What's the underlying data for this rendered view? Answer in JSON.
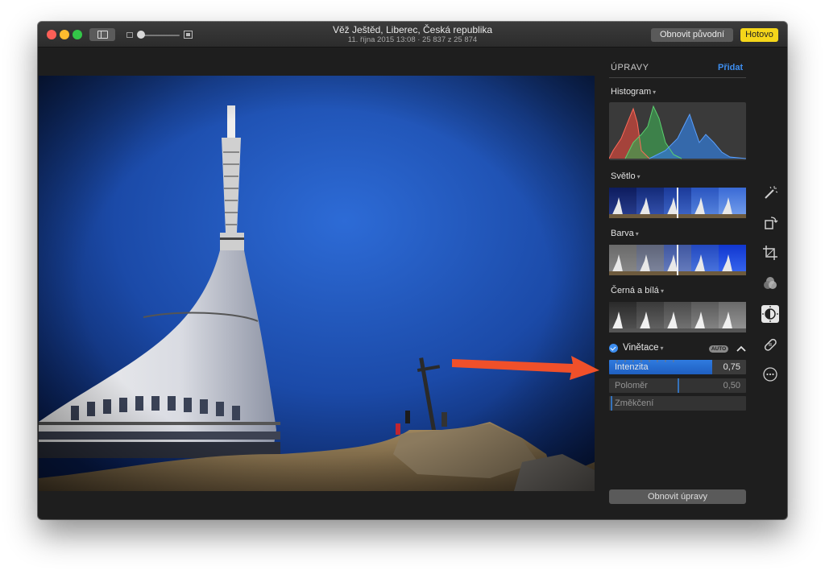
{
  "window": {
    "title": "Věž Ještěd, Liberec, Česká republika",
    "subtitle": "11. října 2015 13:08  ·  25 837 z 25 874",
    "revert_label": "Obnovit původní",
    "done_label": "Hotovo"
  },
  "panel": {
    "header": "ÚPRAVY",
    "add_label": "Přidat",
    "histogram_label": "Histogram",
    "light_label": "Světlo",
    "color_label": "Barva",
    "bw_label": "Černá a bílá",
    "vignette_label": "Vinětace",
    "auto_label": "AUTO",
    "sliders": [
      {
        "label": "Intenzita",
        "value": "0,75",
        "fill": 0.75
      },
      {
        "label": "Poloměr",
        "value": "0,50",
        "fill": 0.5
      },
      {
        "label": "Změkčení",
        "value": "",
        "fill": 0.0
      }
    ],
    "reset_label": "Obnovit úpravy"
  },
  "tools": [
    "magic-wand-icon",
    "rotate-icon",
    "crop-icon",
    "filters-icon",
    "adjust-icon",
    "retouch-icon",
    "more-icon"
  ],
  "colors": {
    "accent": "#3d8ef0",
    "done": "#f5d61a",
    "arrow": "#f0502a",
    "sky": "#1b4aa8"
  }
}
